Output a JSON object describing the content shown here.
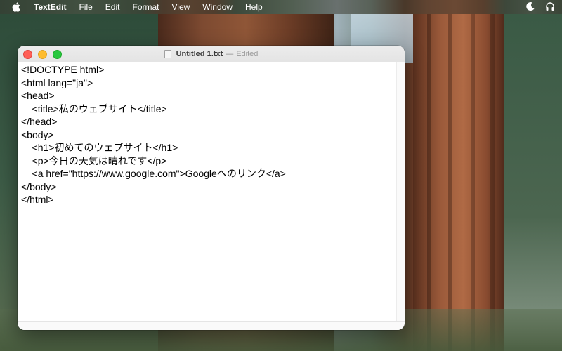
{
  "menubar": {
    "apple_icon": "apple-icon",
    "app_name": "TextEdit",
    "items": [
      "File",
      "Edit",
      "Format",
      "View",
      "Window",
      "Help"
    ],
    "right_icons": [
      "moon-icon",
      "headphones-icon"
    ]
  },
  "window": {
    "filename": "Untitled 1.txt",
    "separator": "—",
    "status": "Edited",
    "lines": [
      "<!DOCTYPE html>",
      "<html lang=\"ja\">",
      "<head>",
      "    <title>私のウェブサイト</title>",
      "</head>",
      "<body>",
      "    <h1>初めてのウェブサイト</h1>",
      "    <p>今日の天気は晴れです</p>",
      "    <a href=\"https://www.google.com\">Googleへのリンク</a>",
      "</body>",
      "</html>"
    ]
  },
  "colors": {
    "close": "#ff5f57",
    "minimize": "#febc2e",
    "maximize": "#28c840"
  }
}
